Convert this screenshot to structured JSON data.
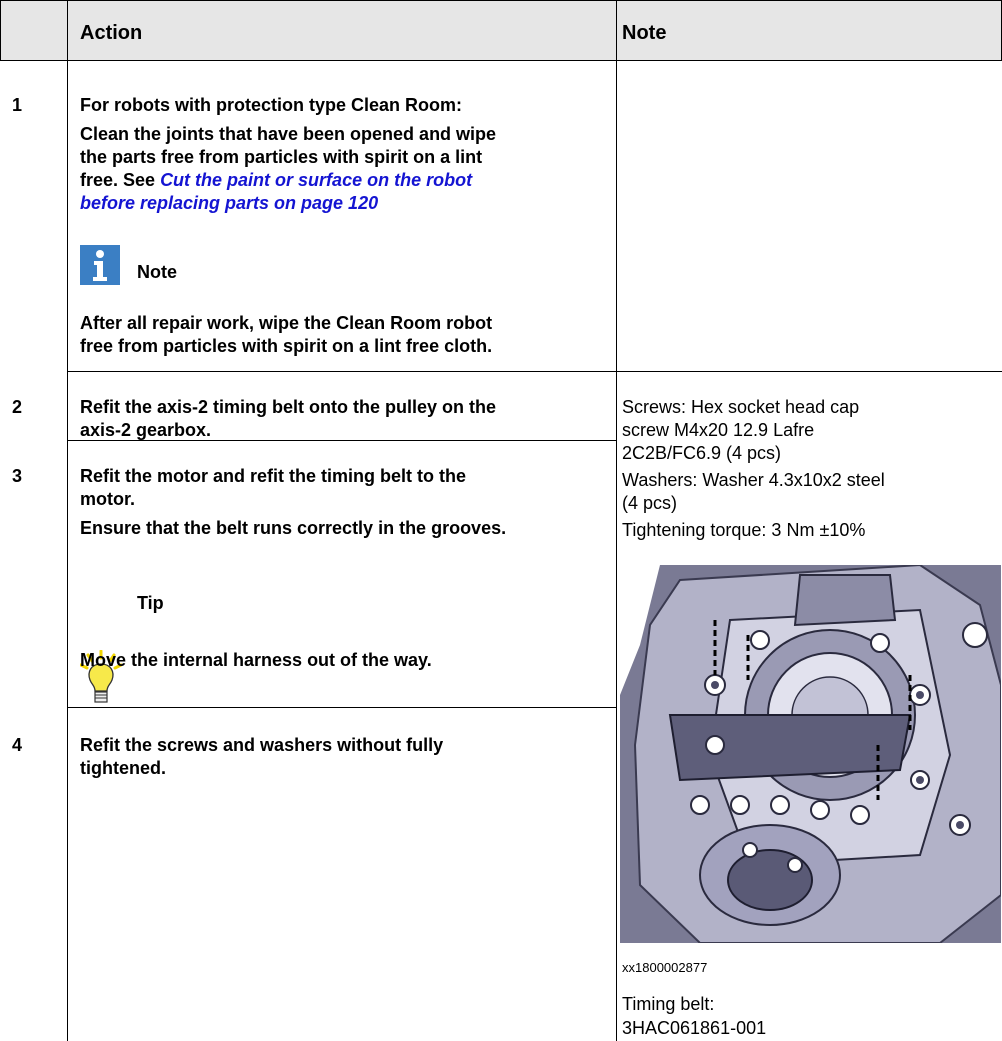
{
  "header": {
    "col_action": "Action",
    "col_note": "Note"
  },
  "rows": [
    {
      "num": "1",
      "lines": [
        "For robots with protection type Clean Room:",
        "Clean the joints that have been opened and wipe",
        "the parts free from particles with spirit on a lint"
      ],
      "ref_prefix": "free. See ",
      "ref_line1": "Cut the paint or surface on the robot",
      "ref_line2": "before replacing parts on page 120",
      "note_label": "Note",
      "note_lines": [
        "After all repair work, wipe the Clean Room robot",
        "free from particles with spirit on a lint free cloth."
      ]
    },
    {
      "num": "2",
      "lines": [
        "Refit the axis-2 timing belt onto the pulley on the",
        "axis-2 gearbox."
      ]
    },
    {
      "num": "3",
      "lines": [
        "Refit the motor and refit the timing belt to the",
        "motor.",
        "Ensure that the belt runs correctly in the grooves."
      ],
      "tip_label": "Tip",
      "tip_text": "Move the internal harness out of the way."
    },
    {
      "num": "4",
      "lines": [
        "Refit the screws and washers without fully",
        "tightened."
      ]
    }
  ],
  "spec": {
    "screws": [
      "Screws: Hex socket head cap",
      "screw M4x20 12.9 Lafre",
      "2C2B/FC6.9 (4 pcs)"
    ],
    "washers": [
      "Washers: Washer 4.3x10x2 steel",
      "(4 pcs)"
    ],
    "torque": "Tightening torque: 3 Nm ±10%",
    "figure_id": "xx1800002877",
    "timing_belt": [
      "Timing belt:",
      "3HAC061861-001"
    ]
  },
  "colors": {
    "header_bg": "#e6e6e6",
    "link": "#1414d2",
    "note_icon": "#3b7fc4",
    "tip_bulb": "#f7e94a"
  }
}
